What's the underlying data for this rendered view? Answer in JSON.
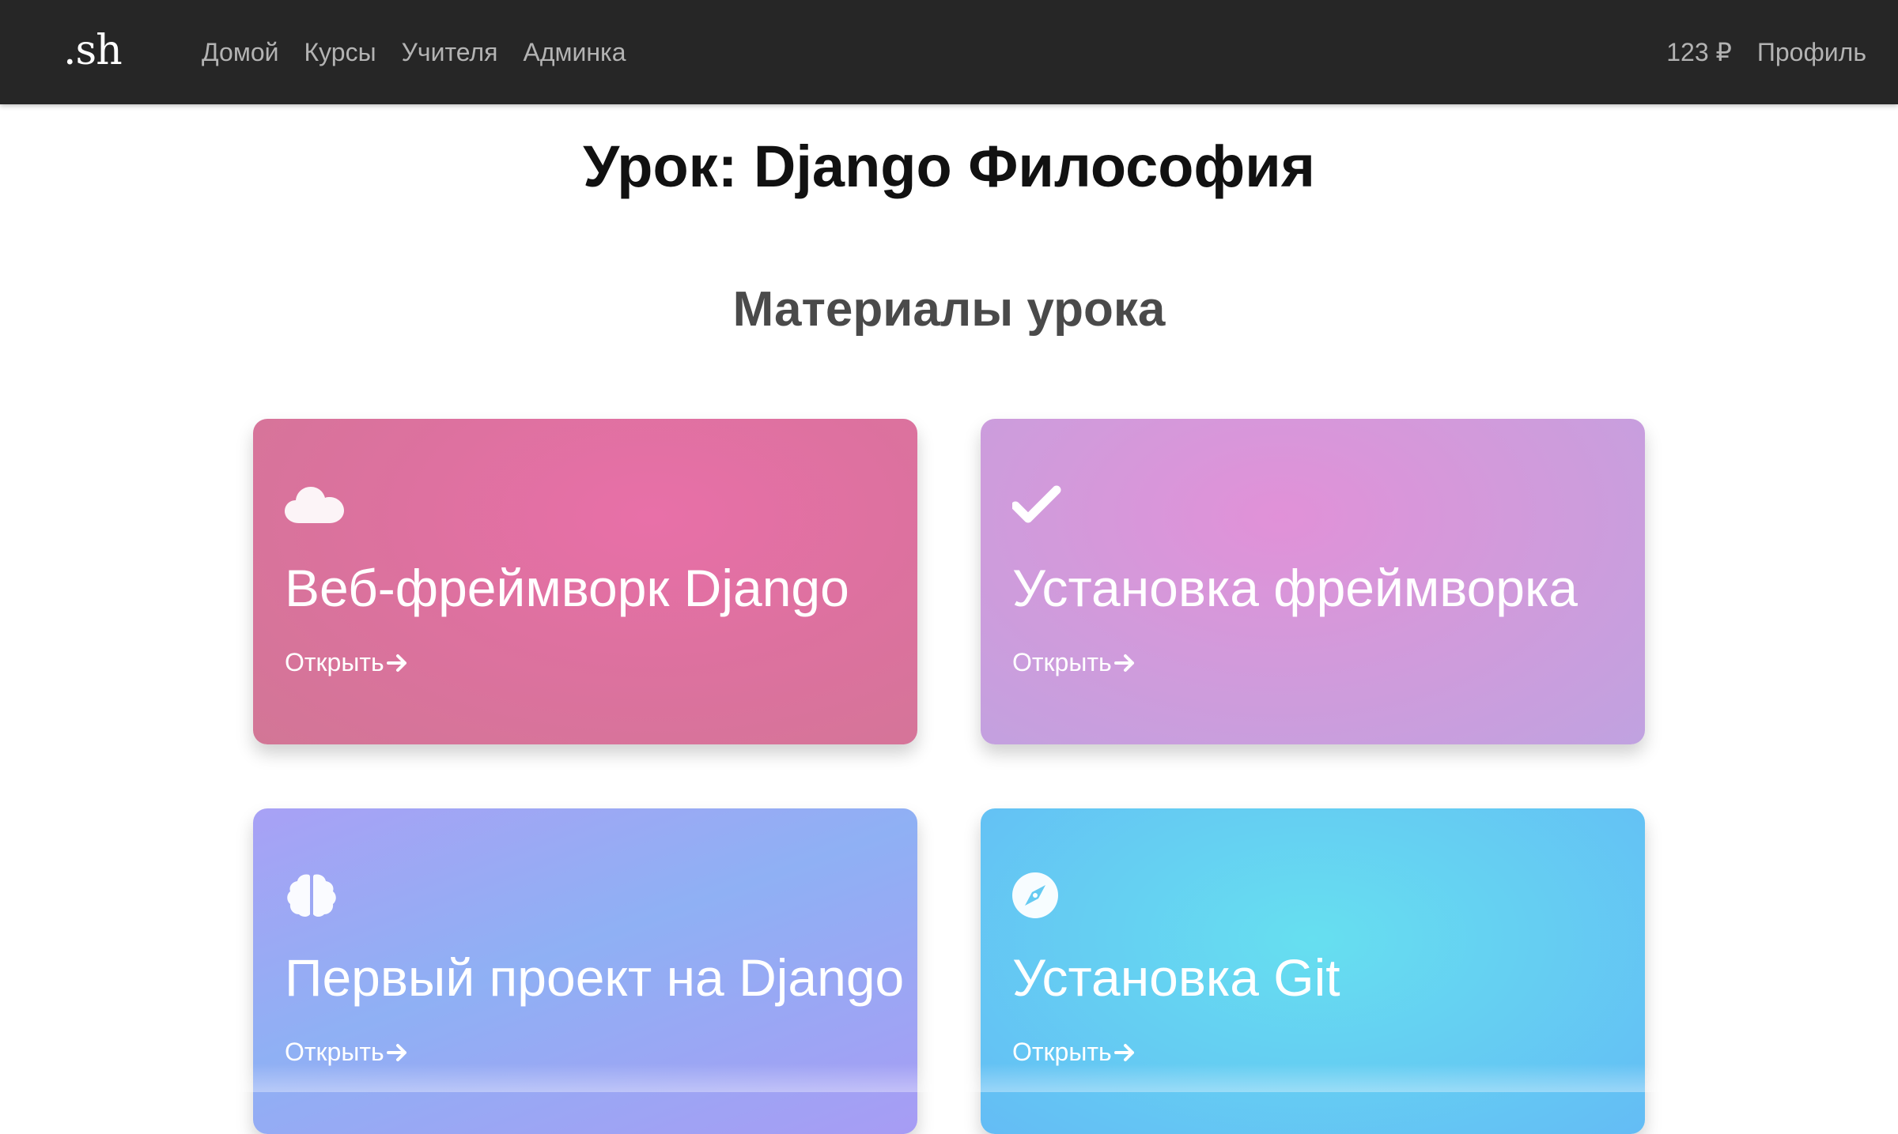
{
  "navbar": {
    "logo": ".sh",
    "links": [
      {
        "label": "Домой"
      },
      {
        "label": "Курсы"
      },
      {
        "label": "Учителя"
      },
      {
        "label": "Админка"
      }
    ],
    "balance": "123 ₽",
    "profile": "Профиль"
  },
  "page": {
    "title": "Урок: Django Философия",
    "section_title": "Материалы урока"
  },
  "cards": [
    {
      "title": "Веб-фреймворк Django",
      "open_label": "Открыть",
      "icon": "cloud-icon",
      "color": "#e070a5"
    },
    {
      "title": "Установка фреймворка",
      "open_label": "Открыть",
      "icon": "checkmark-icon",
      "color": "#d39bdc"
    },
    {
      "title": "Первый проект на Django",
      "open_label": "Открыть",
      "icon": "brain-icon",
      "color": "#9aaaf4"
    },
    {
      "title": "Установка Git",
      "open_label": "Открыть",
      "icon": "compass-icon",
      "color": "#66d2f2"
    }
  ]
}
